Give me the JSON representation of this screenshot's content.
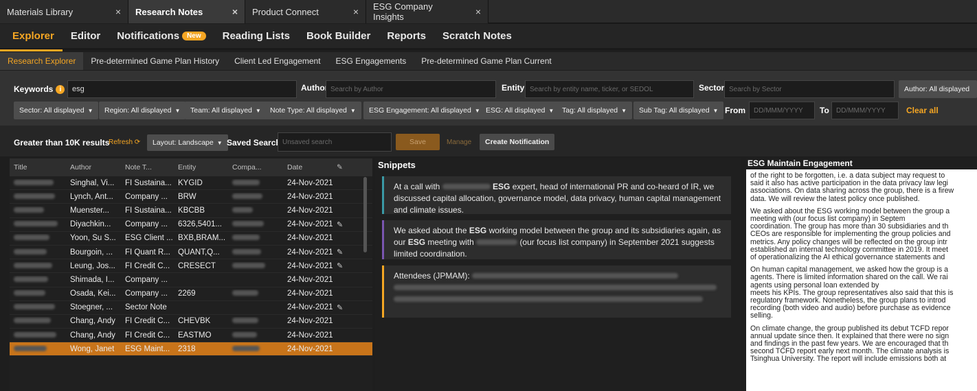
{
  "tabs": [
    {
      "label": "Materials Library",
      "active": false
    },
    {
      "label": "Research Notes",
      "active": true
    },
    {
      "label": "Product Connect",
      "active": false
    },
    {
      "label": "ESG Company Insights",
      "active": false
    }
  ],
  "main_nav": [
    "Explorer",
    "Editor",
    "Notifications",
    "Reading Lists",
    "Book Builder",
    "Reports",
    "Scratch Notes"
  ],
  "notifications_badge": "New",
  "sub_nav": [
    "Research Explorer",
    "Pre-determined Game Plan History",
    "Client Led Engagement",
    "ESG Engagements",
    "Pre-determined Game Plan Current"
  ],
  "filters": {
    "keywords_label": "Keywords",
    "keywords_value": "esg",
    "author_label": "Author",
    "author_placeholder": "Search by Author",
    "entity_label": "Entity",
    "entity_placeholder": "Search by entity name, ticker, or SEDOL",
    "sector_label": "Sector",
    "sector_placeholder": "Search by Sector",
    "author_dropdown": "Author: All displayed",
    "dropdowns": [
      "Sector: All displayed",
      "Region: All displayed",
      "Team: All displayed",
      "Note Type: All displayed",
      "ESG Engagement: All displayed",
      "ESG: All displayed",
      "Tag: All displayed",
      "Sub Tag: All displayed"
    ],
    "from_label": "From",
    "to_label": "To",
    "date_placeholder": "DD/MMM/YYYY",
    "clear_all": "Clear all"
  },
  "results": {
    "count_text": "Greater than 10K results",
    "refresh": "Refresh",
    "layout": "Layout: Landscape",
    "saved_search_label": "Saved Search",
    "saved_search_placeholder": "Unsaved search",
    "save": "Save",
    "manage": "Manage",
    "create_notification": "Create Notification"
  },
  "table": {
    "columns": [
      "Title",
      "Author",
      "Note T...",
      "Entity",
      "Compa...",
      "Date"
    ],
    "rows": [
      {
        "author": "Singhal, Vi...",
        "note_type": "FI Sustaina...",
        "entity": "KYGID",
        "date": "24-Nov-2021",
        "clip": false
      },
      {
        "author": "Lynch, Ant...",
        "note_type": "Company ...",
        "entity": "BRW",
        "date": "24-Nov-2021",
        "clip": false
      },
      {
        "author": "Muenster...",
        "note_type": "FI Sustaina...",
        "entity": "KBCBB",
        "date": "24-Nov-2021",
        "clip": false
      },
      {
        "author": "Diyachkin...",
        "note_type": "Company ...",
        "entity": "6326,5401...",
        "date": "24-Nov-2021",
        "clip": true
      },
      {
        "author": "Yoon, Su S...",
        "note_type": "ESG Client ...",
        "entity": "BXB,BRAM...",
        "date": "24-Nov-2021",
        "clip": false
      },
      {
        "author": "Bourgoin, ...",
        "note_type": "FI Quant R...",
        "entity": "QUANT,Q...",
        "date": "24-Nov-2021",
        "clip": true
      },
      {
        "author": "Leung, Jos...",
        "note_type": "FI Credit C...",
        "entity": "CRESECT",
        "date": "24-Nov-2021",
        "clip": true
      },
      {
        "author": "Shimada, I...",
        "note_type": "Company ...",
        "entity": "",
        "date": "24-Nov-2021",
        "clip": false
      },
      {
        "author": "Osada, Kei...",
        "note_type": "Company ...",
        "entity": "2269",
        "date": "24-Nov-2021",
        "clip": false
      },
      {
        "author": "Stoegner, ...",
        "note_type": "Sector Note",
        "entity": "",
        "date": "24-Nov-2021",
        "clip": true
      },
      {
        "author": "Chang, Andy",
        "note_type": "FI Credit C...",
        "entity": "CHEVBK",
        "date": "24-Nov-2021",
        "clip": false
      },
      {
        "author": "Chang, Andy",
        "note_type": "FI Credit C...",
        "entity": "EASTMO",
        "date": "24-Nov-2021",
        "clip": false
      },
      {
        "author": "Wong, Janet",
        "note_type": "ESG Maint...",
        "entity": "2318",
        "date": "24-Nov-2021",
        "clip": false,
        "selected": true
      }
    ]
  },
  "snippets": {
    "title": "Snippets",
    "cards": [
      {
        "pre": "At a call with",
        "bold": "ESG",
        "post": "expert, head of international PR and co-heard of IR, we discussed capital allocation, governance model, data privacy, human capital management and climate issues.",
        "color": "#3a9aa5"
      },
      {
        "pre": "We asked about the",
        "bold": "ESG",
        "post": "working model between the group and its subsidiaries again, as our",
        "bold2": "ESG",
        "post2": "meeting with",
        "post3": "(our focus list company) in September 2021 suggests limited coordination.",
        "color": "#7a55b0"
      },
      {
        "pre": "Attendees (JPMAM):",
        "color": "#f5a623"
      }
    ]
  },
  "detail": {
    "title": "ESG Maintain Engagement",
    "paragraphs": [
      [
        "of the right to be forgotten, i.e. a data subject may request to",
        "said it also has active participation in the data privacy law legi",
        "associations. On data sharing across the group, there is a firew",
        "data. We will review the latest policy once published."
      ],
      [
        "We asked about the ESG working model between the group a",
        "meeting with (our focus list company) in Septem",
        "coordination. The group has more than 30 subsidiaries and th",
        "CEOs are responsible for implementing the group policies and",
        "metrics. Any policy changes will be reflected on the group intr",
        "established an internal technology committee in 2019. It meet",
        "of operationalizing the AI ethical governance statements and"
      ],
      [
        "On human capital management, we asked how the group is a",
        "agents. There is limited information shared on the call. We rai",
        "agents using personal loan extended by",
        "meets his KPIs. The group representatives also said that this is",
        "regulatory framework. Nonetheless, the group plans to introd",
        "recording (both video and audio) before purchase as evidence",
        "selling."
      ],
      [
        "On climate change, the group published its debut TCFD repor",
        "annual update since then. It explained that there were no sign",
        "and findings in the past few years. We are encouraged that th",
        "second TCFD report early next month. The climate analysis is",
        "Tsinghua University. The report will include emissions both at"
      ]
    ]
  },
  "colors": {
    "accent": "#f5a623",
    "selected_row": "#c8741a"
  }
}
